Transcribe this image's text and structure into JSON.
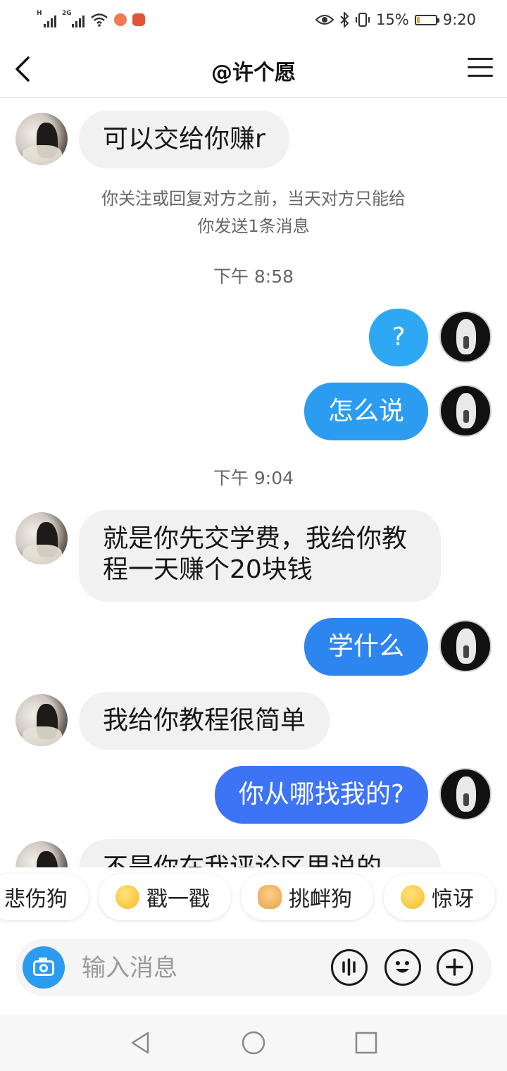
{
  "status_bar": {
    "signal1_label": "H",
    "signal2_label": "2G",
    "battery_text": "15%",
    "battery_level": 0.15,
    "battery_color": "#f39a2b",
    "time": "9:20"
  },
  "header": {
    "title": "@许个愿",
    "back_icon": "chevron-left-icon",
    "menu_icon": "hamburger-menu-icon"
  },
  "messages": [
    {
      "side": "in",
      "text": "可以交给你赚r"
    },
    {
      "side": "out",
      "text": "?",
      "color": "#2fa8f4"
    },
    {
      "side": "out",
      "text": "怎么说",
      "color": "#2c9cf0"
    },
    {
      "side": "in",
      "text": "就是你先交学费，我给你教程一天赚个20块钱"
    },
    {
      "side": "out",
      "text": "学什么",
      "color": "#2d86f0"
    },
    {
      "side": "in",
      "text": "我给你教程很简单"
    },
    {
      "side": "out",
      "text": "你从哪找我的?",
      "color": "#3d73f5"
    },
    {
      "side": "in",
      "text": "不是你在我评论区里说的"
    }
  ],
  "notice": "你关注或回复对方之前，当天对方只能给你发送1条消息",
  "timestamps": [
    "下午 8:58",
    "下午 9:04"
  ],
  "stickers": [
    {
      "label": "悲伤狗"
    },
    {
      "label": "戳一戳",
      "icon": "poke-emoji-icon"
    },
    {
      "label": "挑衅狗",
      "icon": "doge-emoji-icon"
    },
    {
      "label": "惊讶",
      "icon": "surprised-emoji-icon"
    }
  ],
  "input": {
    "placeholder": "输入消息",
    "camera_icon": "camera-icon",
    "voice_icon": "voice-wave-icon",
    "emoji_icon": "smiley-icon",
    "plus_icon": "plus-icon"
  },
  "nav": {
    "back_icon": "triangle-back-icon",
    "home_icon": "circle-home-icon",
    "recents_icon": "square-recents-icon"
  }
}
